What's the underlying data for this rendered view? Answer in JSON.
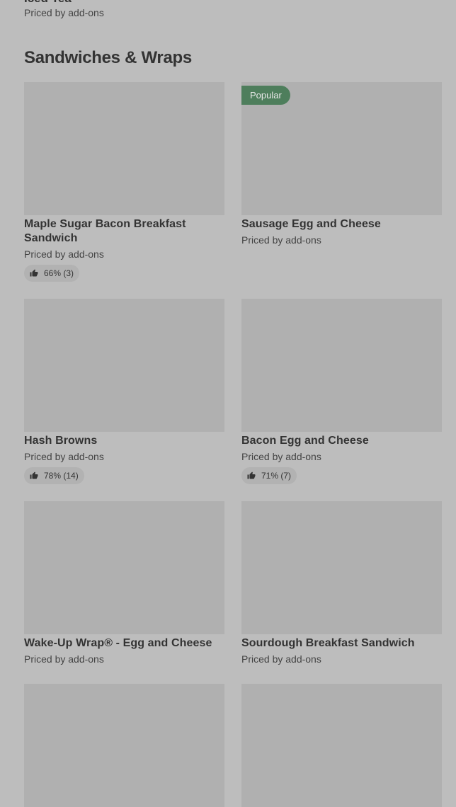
{
  "previous_item": {
    "title": "Iced Tea",
    "price": "Priced by add-ons"
  },
  "section": {
    "title": "Sandwiches & Wraps"
  },
  "items": [
    {
      "name": "Maple Sugar Bacon Breakfast Sandwich",
      "price": "Priced by add-ons",
      "rating": "66% (3)",
      "badge": ""
    },
    {
      "name": "Sausage Egg and Cheese",
      "price": "Priced by add-ons",
      "rating": "",
      "badge": "Popular"
    },
    {
      "name": "Hash Browns",
      "price": "Priced by add-ons",
      "rating": "78% (14)",
      "badge": ""
    },
    {
      "name": "Bacon Egg and Cheese",
      "price": "Priced by add-ons",
      "rating": "71% (7)",
      "badge": ""
    },
    {
      "name": "Wake-Up Wrap® - Egg and Cheese",
      "price": "Priced by add-ons",
      "rating": "",
      "badge": ""
    },
    {
      "name": "Sourdough Breakfast Sandwich",
      "price": "Priced by add-ons",
      "rating": "",
      "badge": ""
    }
  ],
  "icons": {
    "rating": "thumbs-up-icon"
  },
  "colors": {
    "background": "#bdbdbd",
    "image_placeholder": "#b0b0b0",
    "popular_badge": "#4e7e5c"
  }
}
